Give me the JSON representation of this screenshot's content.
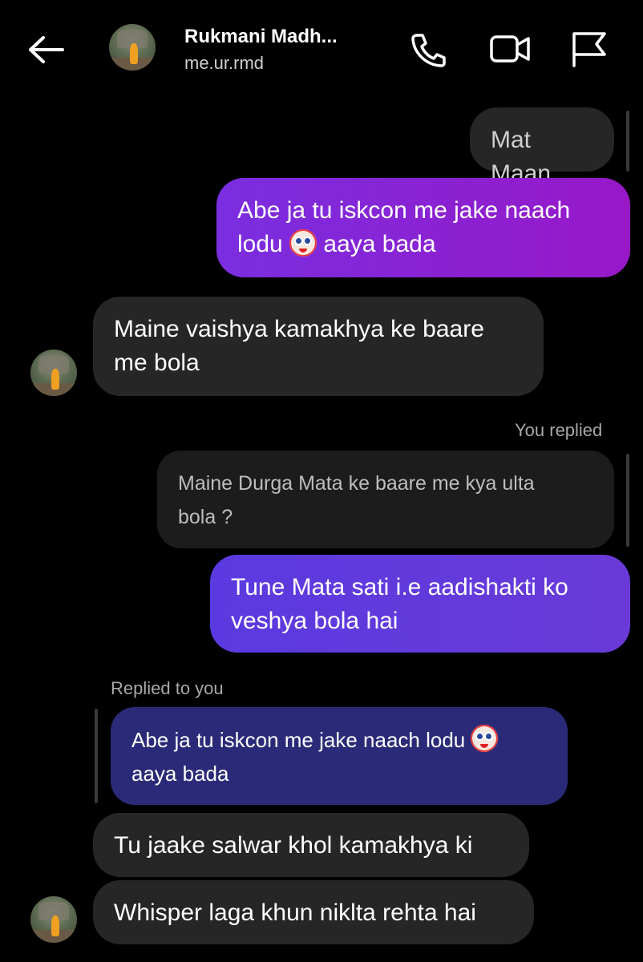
{
  "header": {
    "contact_name": "Rukmani Madh...",
    "username": "me.ur.rmd",
    "icons": [
      "back-arrow-icon",
      "phone-icon",
      "video-icon",
      "flag-icon"
    ]
  },
  "messages": {
    "m1": "Mat Maan",
    "m2_part1": "Abe ja tu iskcon me jake naach\nlodu ",
    "m2_part2": " aaya bada",
    "m3": "Maine vaishya kamakhya ke baare\nme bola",
    "you_replied": "You replied",
    "m4_quoted": "Maine Durga Mata ke baare me kya ulta\nbola ?",
    "m5": "Tune Mata sati i.e aadishakti ko\nveshya bola hai",
    "replied_to_you": "Replied to you",
    "m6_quoted_part1": "Abe ja tu iskcon me jake naach lodu ",
    "m6_quoted_part2": "\naaya bada",
    "m7": "Tu jaake salwar khol kamakhya ki",
    "m8": "Whisper laga khun niklta rehta hai"
  },
  "colors": {
    "background": "#000000",
    "incoming_bubble": "#262626",
    "outgoing_purple": "#9818c8",
    "outgoing_violet": "#5a3ae0",
    "quoted_navy": "#2b2a78"
  }
}
